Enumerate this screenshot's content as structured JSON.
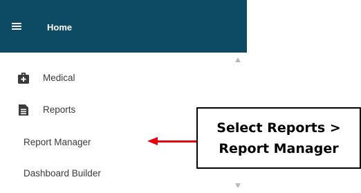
{
  "header": {
    "title": "Home",
    "menu_icon": "hamburger-menu-icon"
  },
  "nav": {
    "items": [
      {
        "label": "Medical",
        "icon": "medical-bag-icon"
      },
      {
        "label": "Reports",
        "icon": "document-icon"
      },
      {
        "label": "Report Manager"
      },
      {
        "label": "Dashboard Builder"
      }
    ]
  },
  "callout": {
    "line1": "Select Reports >",
    "line2": "Report Manager"
  },
  "colors": {
    "header_bg": "#0d4a63",
    "arrow": "#e4000f",
    "text": "#3a3a3a"
  }
}
